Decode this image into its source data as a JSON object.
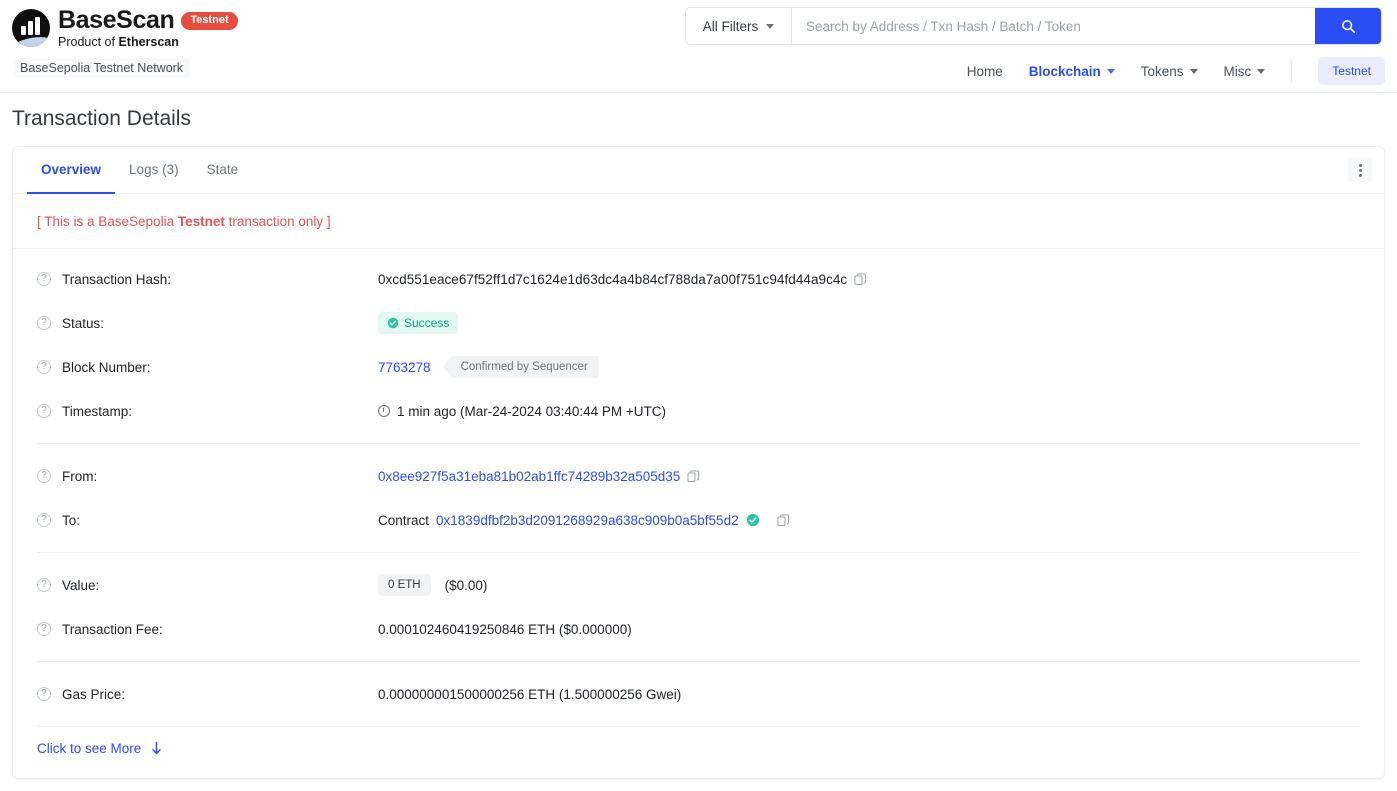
{
  "brand": {
    "name": "BaseScan",
    "badge": "Testnet",
    "subtitle_prefix": "Product of ",
    "subtitle_strong": "Etherscan",
    "network_label": "BaseSepolia Testnet Network",
    "logo_icon": "basescan-logo-icon"
  },
  "search": {
    "filter_label": "All Filters",
    "placeholder": "Search by Address / Txn Hash / Batch / Token",
    "value": "",
    "button_icon": "search-icon"
  },
  "nav": {
    "items": [
      {
        "label": "Home",
        "has_caret": false,
        "active": false
      },
      {
        "label": "Blockchain",
        "has_caret": true,
        "active": true
      },
      {
        "label": "Tokens",
        "has_caret": true,
        "active": false
      },
      {
        "label": "Misc",
        "has_caret": true,
        "active": false
      }
    ],
    "network_button": "Testnet"
  },
  "page": {
    "title": "Transaction Details"
  },
  "tabs": [
    {
      "label": "Overview",
      "active": true
    },
    {
      "label": "Logs (3)",
      "active": false
    },
    {
      "label": "State",
      "active": false
    }
  ],
  "menu_icon": "kebab-menu-icon",
  "notice": {
    "prefix": "[ This is a BaseSepolia ",
    "strong": "Testnet",
    "suffix": " transaction only ]"
  },
  "details": {
    "transaction_hash": {
      "label": "Transaction Hash:",
      "value": "0xcd551eace67f52ff1d7c1624e1d63dc4a4b84cf788da7a00f751c94fd44a9c4c"
    },
    "status": {
      "label": "Status:",
      "value": "Success"
    },
    "block_number": {
      "label": "Block Number:",
      "value": "7763278",
      "badge": "Confirmed by Sequencer"
    },
    "timestamp": {
      "label": "Timestamp:",
      "value": "1 min ago (Mar-24-2024 03:40:44 PM +UTC)"
    },
    "from": {
      "label": "From:",
      "value": "0x8ee927f5a31eba81b02ab1ffc74289b32a505d35"
    },
    "to": {
      "label": "To:",
      "prefix": "Contract",
      "value": "0x1839dfbf2b3d2091268929a638c909b0a5bf55d2"
    },
    "value": {
      "label": "Value:",
      "amount": "0 ETH",
      "fiat": "($0.00)"
    },
    "transaction_fee": {
      "label": "Transaction Fee:",
      "value": "0.000102460419250846 ETH ($0.000000)"
    },
    "gas_price": {
      "label": "Gas Price:",
      "value": "0.000000001500000256 ETH (1.500000256 Gwei)"
    }
  },
  "see_more": {
    "label": "Click to see More",
    "icon": "arrow-down-icon"
  },
  "colors": {
    "accent_blue": "#2b4df5",
    "success_green": "#00a186",
    "testnet_red": "#e74c3c",
    "notice_red": "#e55353"
  }
}
